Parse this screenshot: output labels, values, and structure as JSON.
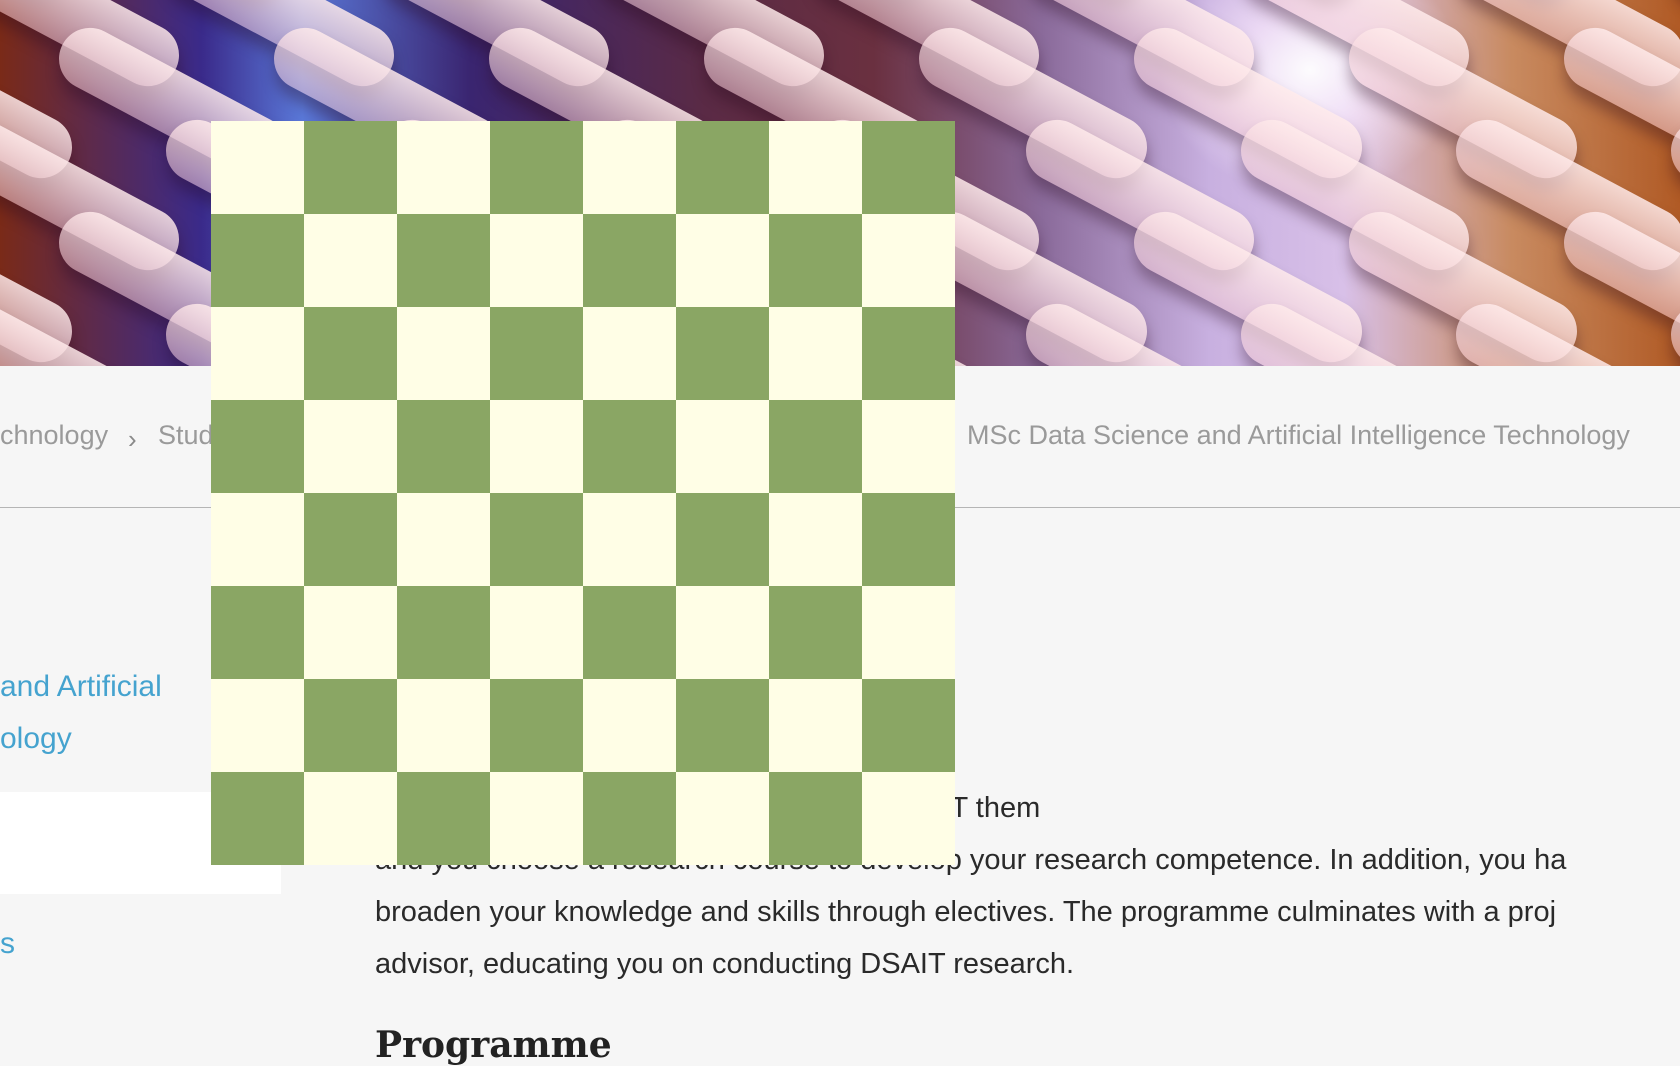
{
  "hero": {
    "image_name": "abstract-rounded-bars-banner"
  },
  "breadcrumb": {
    "items": [
      "chnology",
      "Stud",
      "MSc Data Science and Artificial Intelligence Technology"
    ]
  },
  "sidebar": {
    "active_item_lines": [
      " and Artificial",
      "ology"
    ],
    "next_item_label": "s"
  },
  "main": {
    "paragraph_lines": [
      "pon the common core. You choose two DSAIT them",
      "and you choose a research course to develop your research competence. In addition, you ha",
      "broaden your knowledge and skills through electives. The programme culminates with a proj",
      "advisor, educating you on conducting DSAIT research."
    ],
    "section_heading": "Programme"
  },
  "board": {
    "rows": 8,
    "cols": 8,
    "light_color": "#fffee6",
    "dark_color": "#8aa664",
    "top_left": "light"
  },
  "colors": {
    "link": "#45a3cf",
    "breadcrumb_text": "#9a9a9a",
    "body_text": "#2a2a2a",
    "page_bg": "#f6f6f6"
  }
}
